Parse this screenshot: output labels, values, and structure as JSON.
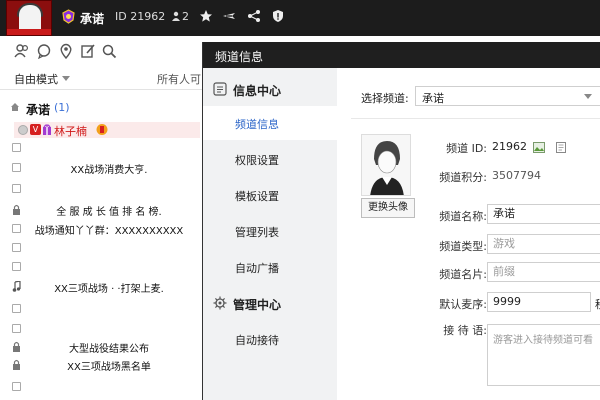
{
  "topbar": {
    "name": "承诺",
    "id_text": "ID 21962",
    "users_text": "2",
    "icons": [
      "badge-icon",
      "person-icon",
      "star-icon",
      "plane-icon",
      "share-icon",
      "shield-icon"
    ]
  },
  "leftpanel": {
    "mode_label": "自由模式",
    "mode_right": "所有人可",
    "root_channel": {
      "name": "承诺",
      "count": "(1)"
    },
    "user": {
      "badge": "V",
      "name": "林子楠"
    },
    "subchannels": [
      "",
      "XX战场消费大亨.",
      "",
      "全 服 成 长 值 排 名 榜.",
      "战场通知丫丫群：XXXXXXXXXX",
      "",
      "",
      "XX三项战场 · ·打架上麦.",
      "",
      "",
      "大型战役结果公布",
      "XX三项战场黑名单",
      ""
    ]
  },
  "dialog": {
    "title": "频道信息",
    "nav": {
      "section1": "信息中心",
      "items1": [
        "频道信息",
        "权限设置",
        "模板设置",
        "管理列表",
        "自动广播"
      ],
      "section2": "管理中心",
      "items2": [
        "自动接待"
      ]
    },
    "select_label": "选择频道:",
    "select_value": "承诺",
    "change_avatar": "更换头像",
    "fields": {
      "id_label": "频道 ID:",
      "id_value": "21962",
      "score_label": "频道积分:",
      "score_value": "3507794",
      "name_label": "频道名称:",
      "name_value": "承诺",
      "type_label": "频道类型:",
      "type_placeholder": "游戏",
      "card_label": "频道名片:",
      "card_placeholder": "前缀",
      "mic_label": "默认麦序:",
      "mic_value": "9999",
      "mic_suffix": "秒",
      "welcome_label": "接 待 语:",
      "welcome_placeholder": "游客进入接待频道可看"
    }
  },
  "colors": {
    "topbar": "#1c1c1c",
    "accent_blue": "#2a64c8",
    "user_red": "#d01818"
  }
}
